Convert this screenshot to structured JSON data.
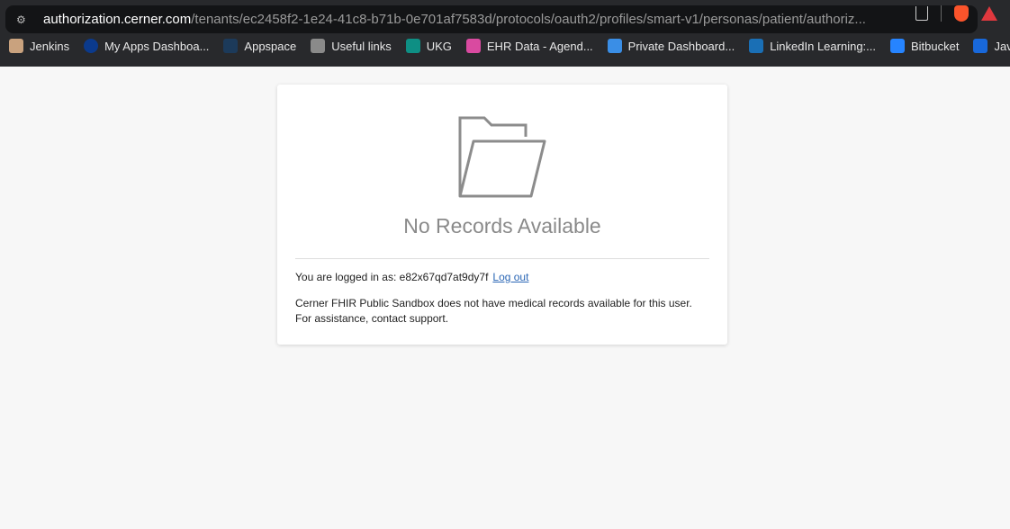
{
  "browser": {
    "url_host": "authorization.cerner.com",
    "url_rest": "/tenants/ec2458f2-1e24-41c8-b71b-0e701af7583d/protocols/oauth2/profiles/smart-v1/personas/patient/authoriz...",
    "bookmarks": [
      {
        "label": "Jenkins",
        "color": "#c9a27e"
      },
      {
        "label": "My Apps Dashboa...",
        "color": "#0b3a8c"
      },
      {
        "label": "Appspace",
        "color": "#1c3a5a"
      },
      {
        "label": "Useful links",
        "color": "#8a8a8a"
      },
      {
        "label": "UKG",
        "color": "#0e8f84"
      },
      {
        "label": "EHR Data - Agend...",
        "color": "#d94aa0"
      },
      {
        "label": "Private Dashboard...",
        "color": "#3a8ee6"
      },
      {
        "label": "LinkedIn Learning:...",
        "color": "#1a6fb5"
      },
      {
        "label": "Bitbucket",
        "color": "#2684ff"
      },
      {
        "label": "Java",
        "color": "#1868db"
      }
    ]
  },
  "card": {
    "icon": "empty-folder-icon",
    "title": "No Records Available",
    "login_prefix": "You are logged in as: e82x67qd7at9dy7f",
    "logout_label": "Log out",
    "message_line1": "Cerner FHIR Public Sandbox does not have medical records available for this user.",
    "message_line2": "For assistance, contact support."
  }
}
